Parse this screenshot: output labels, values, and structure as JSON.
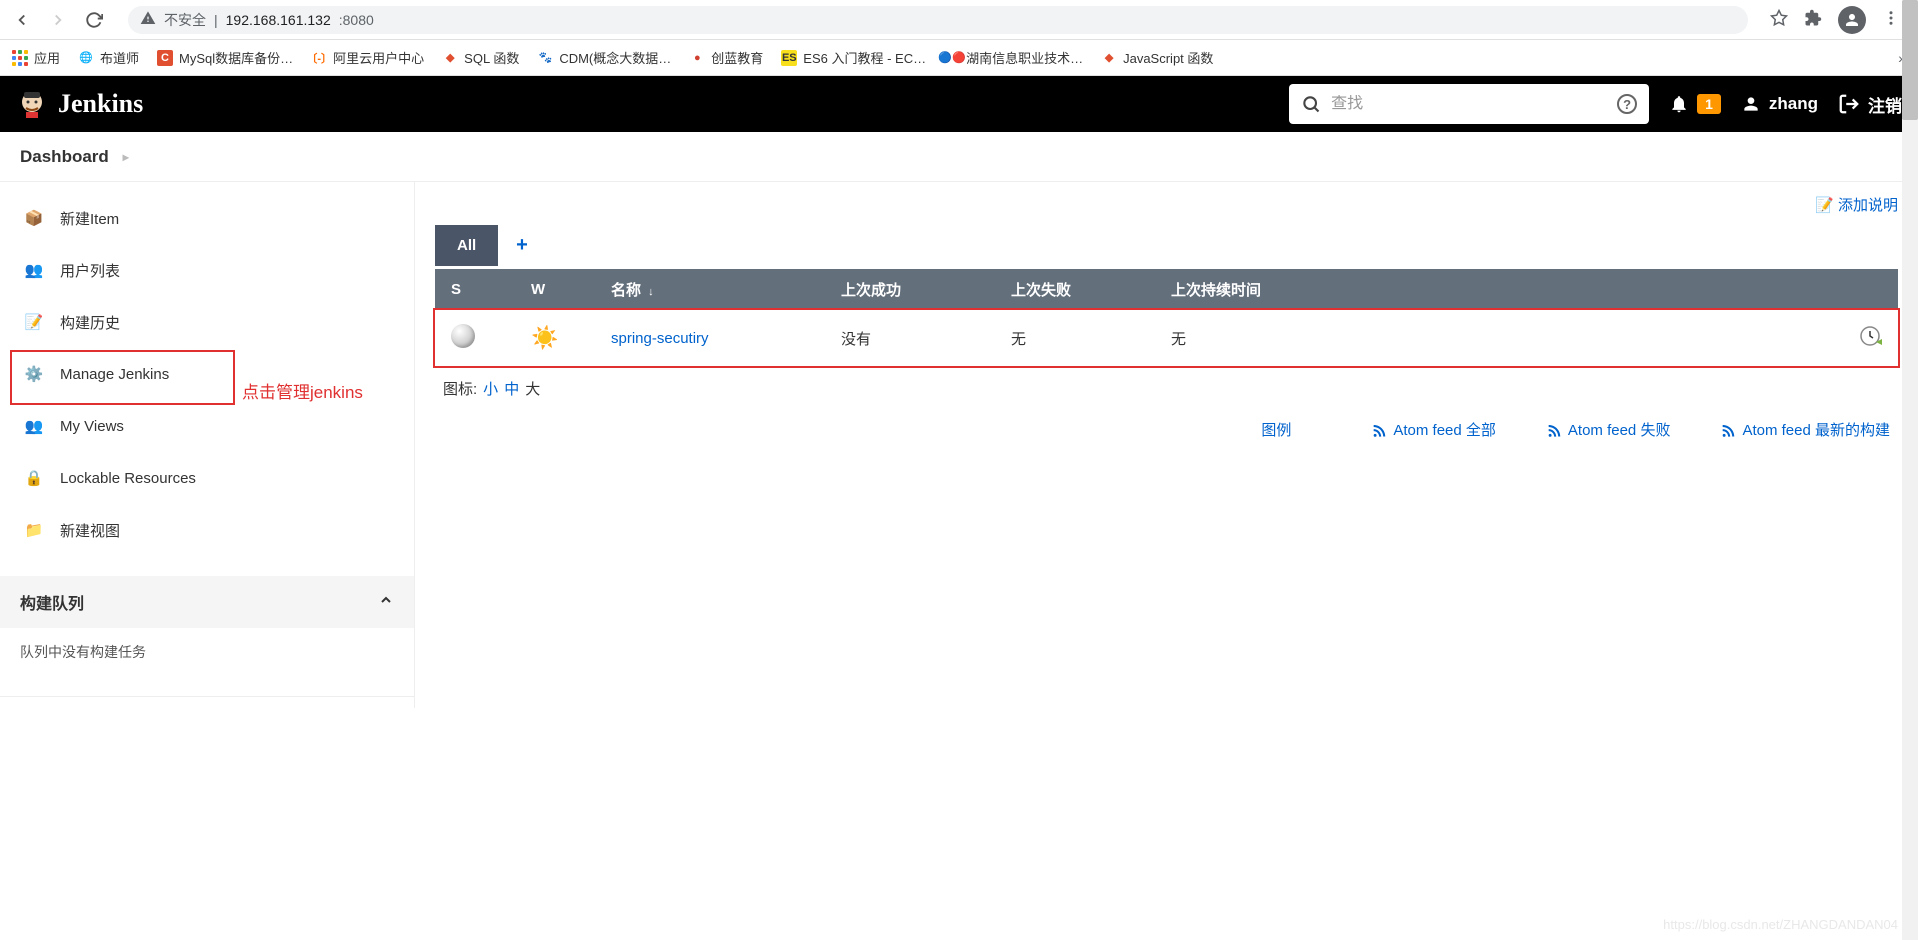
{
  "browser": {
    "security_label": "不安全",
    "url_host": "192.168.161.132",
    "url_port": ":8080"
  },
  "bookmarks": {
    "apps_label": "应用",
    "items": [
      {
        "label": "布道师"
      },
      {
        "label": "MySql数据库备份…"
      },
      {
        "label": "阿里云用户中心"
      },
      {
        "label": "SQL 函数"
      },
      {
        "label": "CDM(概念大数据…"
      },
      {
        "label": "创蓝教育"
      },
      {
        "label": "ES6 入门教程 - EC…"
      },
      {
        "label": "湖南信息职业技术…"
      },
      {
        "label": "JavaScript 函数"
      }
    ]
  },
  "header": {
    "brand": "Jenkins",
    "search_placeholder": "查找",
    "notification_count": "1",
    "username": "zhang",
    "logout": "注销"
  },
  "breadcrumb": {
    "dashboard": "Dashboard"
  },
  "sidebar": {
    "items": [
      {
        "label": "新建Item"
      },
      {
        "label": "用户列表"
      },
      {
        "label": "构建历史"
      },
      {
        "label": "Manage Jenkins"
      },
      {
        "label": "My Views"
      },
      {
        "label": "Lockable Resources"
      },
      {
        "label": "新建视图"
      }
    ],
    "annotation": "点击管理jenkins",
    "panel1_title": "构建队列",
    "panel1_body": "队列中没有构建任务"
  },
  "content": {
    "add_description": "添加说明",
    "tab_all": "All",
    "columns": {
      "s": "S",
      "w": "W",
      "name": "名称",
      "last_success": "上次成功",
      "last_failure": "上次失败",
      "last_duration": "上次持续时间"
    },
    "rows": [
      {
        "name": "spring-secutiry",
        "last_success": "没有",
        "last_failure": "无",
        "last_duration": "无"
      }
    ],
    "icon_label": "图标:",
    "icon_small": "小",
    "icon_medium": "中",
    "icon_large": "大",
    "legend": "图例",
    "feed_all": "Atom feed 全部",
    "feed_fail": "Atom feed 失败",
    "feed_latest": "Atom feed 最新的构建"
  },
  "watermark": "https://blog.csdn.net/ZHANGDANDAN04"
}
